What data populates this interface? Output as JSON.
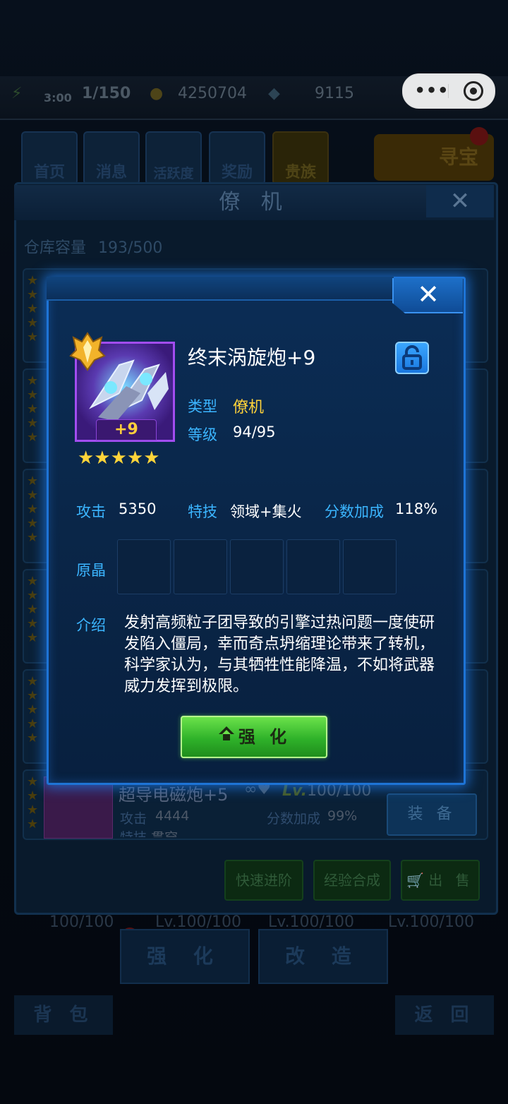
{
  "topbar": {
    "timer": "3:00",
    "stamina": "1/150",
    "gold": "4250704",
    "gems": "9115"
  },
  "nav": {
    "items": [
      "首页",
      "消息",
      "活跃度",
      "奖励",
      "贵族"
    ],
    "treasure": "寻宝"
  },
  "panel": {
    "title": "僚 机",
    "close": "✕",
    "capacity_label": "仓库容量",
    "capacity_value": "193/500"
  },
  "background_item": {
    "name": "超导电磁炮+5",
    "level_prefix": "Lv.",
    "level": "100/100",
    "attack_label": "攻击",
    "attack": "4444",
    "score_label": "分数加成",
    "score": "99%",
    "skill_label": "特技",
    "skill": "贯穿",
    "equip": "装 备"
  },
  "panel_actions": {
    "fast_advance": "快速进阶",
    "exp_merge": "经验合成",
    "sell": "出 售"
  },
  "bottom": {
    "levels": [
      "100/100",
      "Lv.100/100",
      "Lv.100/100",
      "Lv.100/100"
    ],
    "enhance": "强 化",
    "modify": "改 造",
    "backpack": "背 包",
    "back": "返 回"
  },
  "modal": {
    "close": "✕",
    "item_name": "终末涡旋炮+9",
    "plus_badge": "+9",
    "stars": "★★★★★",
    "type_label": "类型",
    "type_value": "僚机",
    "level_label": "等级",
    "level_value": "94/95",
    "attack_label": "攻击",
    "attack_value": "5350",
    "skill_label": "特技",
    "skill_value": "领域+集火",
    "score_label": "分数加成",
    "score_value": "118%",
    "crystal_label": "原晶",
    "intro_label": "介绍",
    "intro_text": "发射高频粒子团导致的引擎过热问题一度使研发陷入僵局，幸而奇点坍缩理论带来了转机，科学家认为，与其牺牲性能降温，不如将武器威力发挥到极限。",
    "enhance_button": "强 化"
  },
  "colors": {
    "label_blue": "#3bb5ff",
    "gold": "#ffd23a",
    "modal_border": "#1e74d6",
    "button_green": "#2fb22a"
  }
}
